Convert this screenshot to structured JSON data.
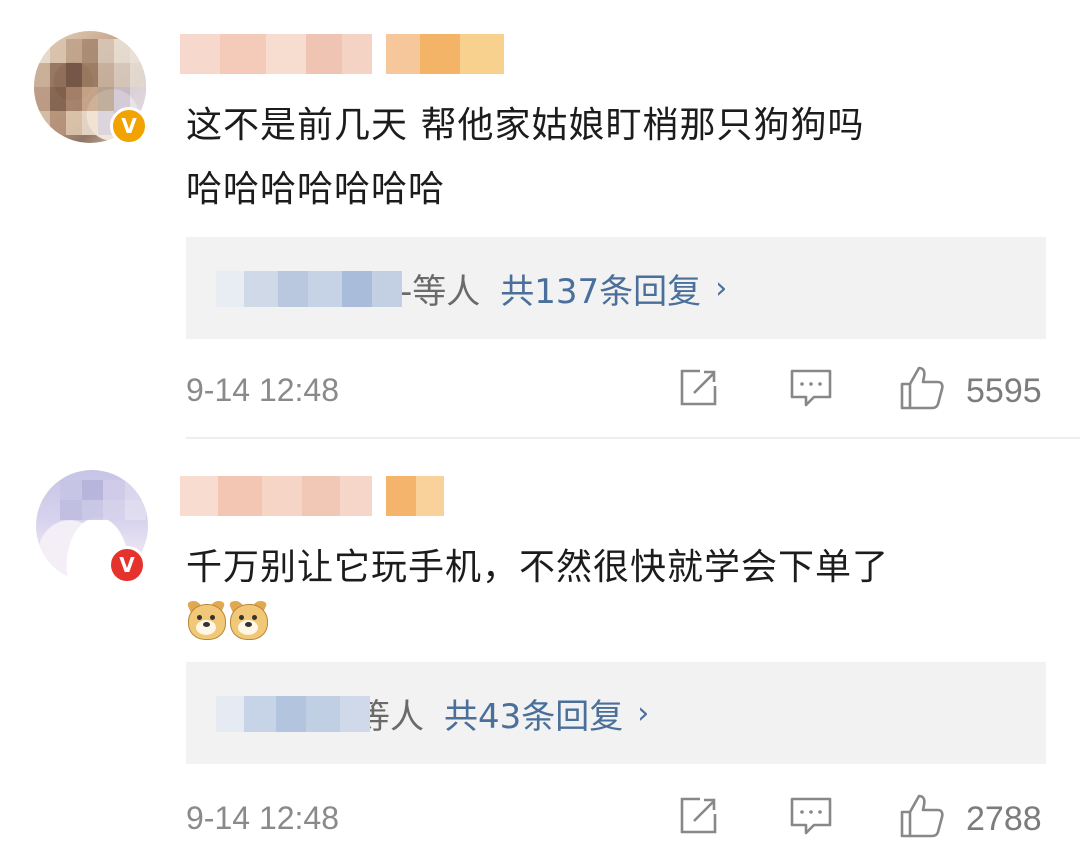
{
  "comments": [
    {
      "text_line1": "这不是前几天 帮他家姑娘盯梢那只狗狗吗",
      "text_line2": "哈哈哈哈哈哈哈",
      "reply_names": "長-等人",
      "reply_count_label": "共137条回复",
      "reply_chevron": "›",
      "time": "9-14 12:48",
      "likes": "5595",
      "verified_badge": "V",
      "badge_color": "#f3a300"
    },
    {
      "text_line1": "千万别让它玩手机，不然很快就学会下单了",
      "emojis": [
        "doge-emoji",
        "doge-emoji"
      ],
      "reply_names": "等人",
      "reply_count_label": "共43条回复",
      "reply_chevron": "›",
      "time": "9-14 12:48",
      "likes": "2788",
      "verified_badge": "V",
      "badge_color": "#e5322d"
    }
  ],
  "icons": {
    "share": "share-icon",
    "comment": "comment-icon",
    "like": "like-icon"
  },
  "colors": {
    "link": "#4a6f9a",
    "reply_bg": "#f2f2f2",
    "meta_text": "#8a8a8a"
  }
}
